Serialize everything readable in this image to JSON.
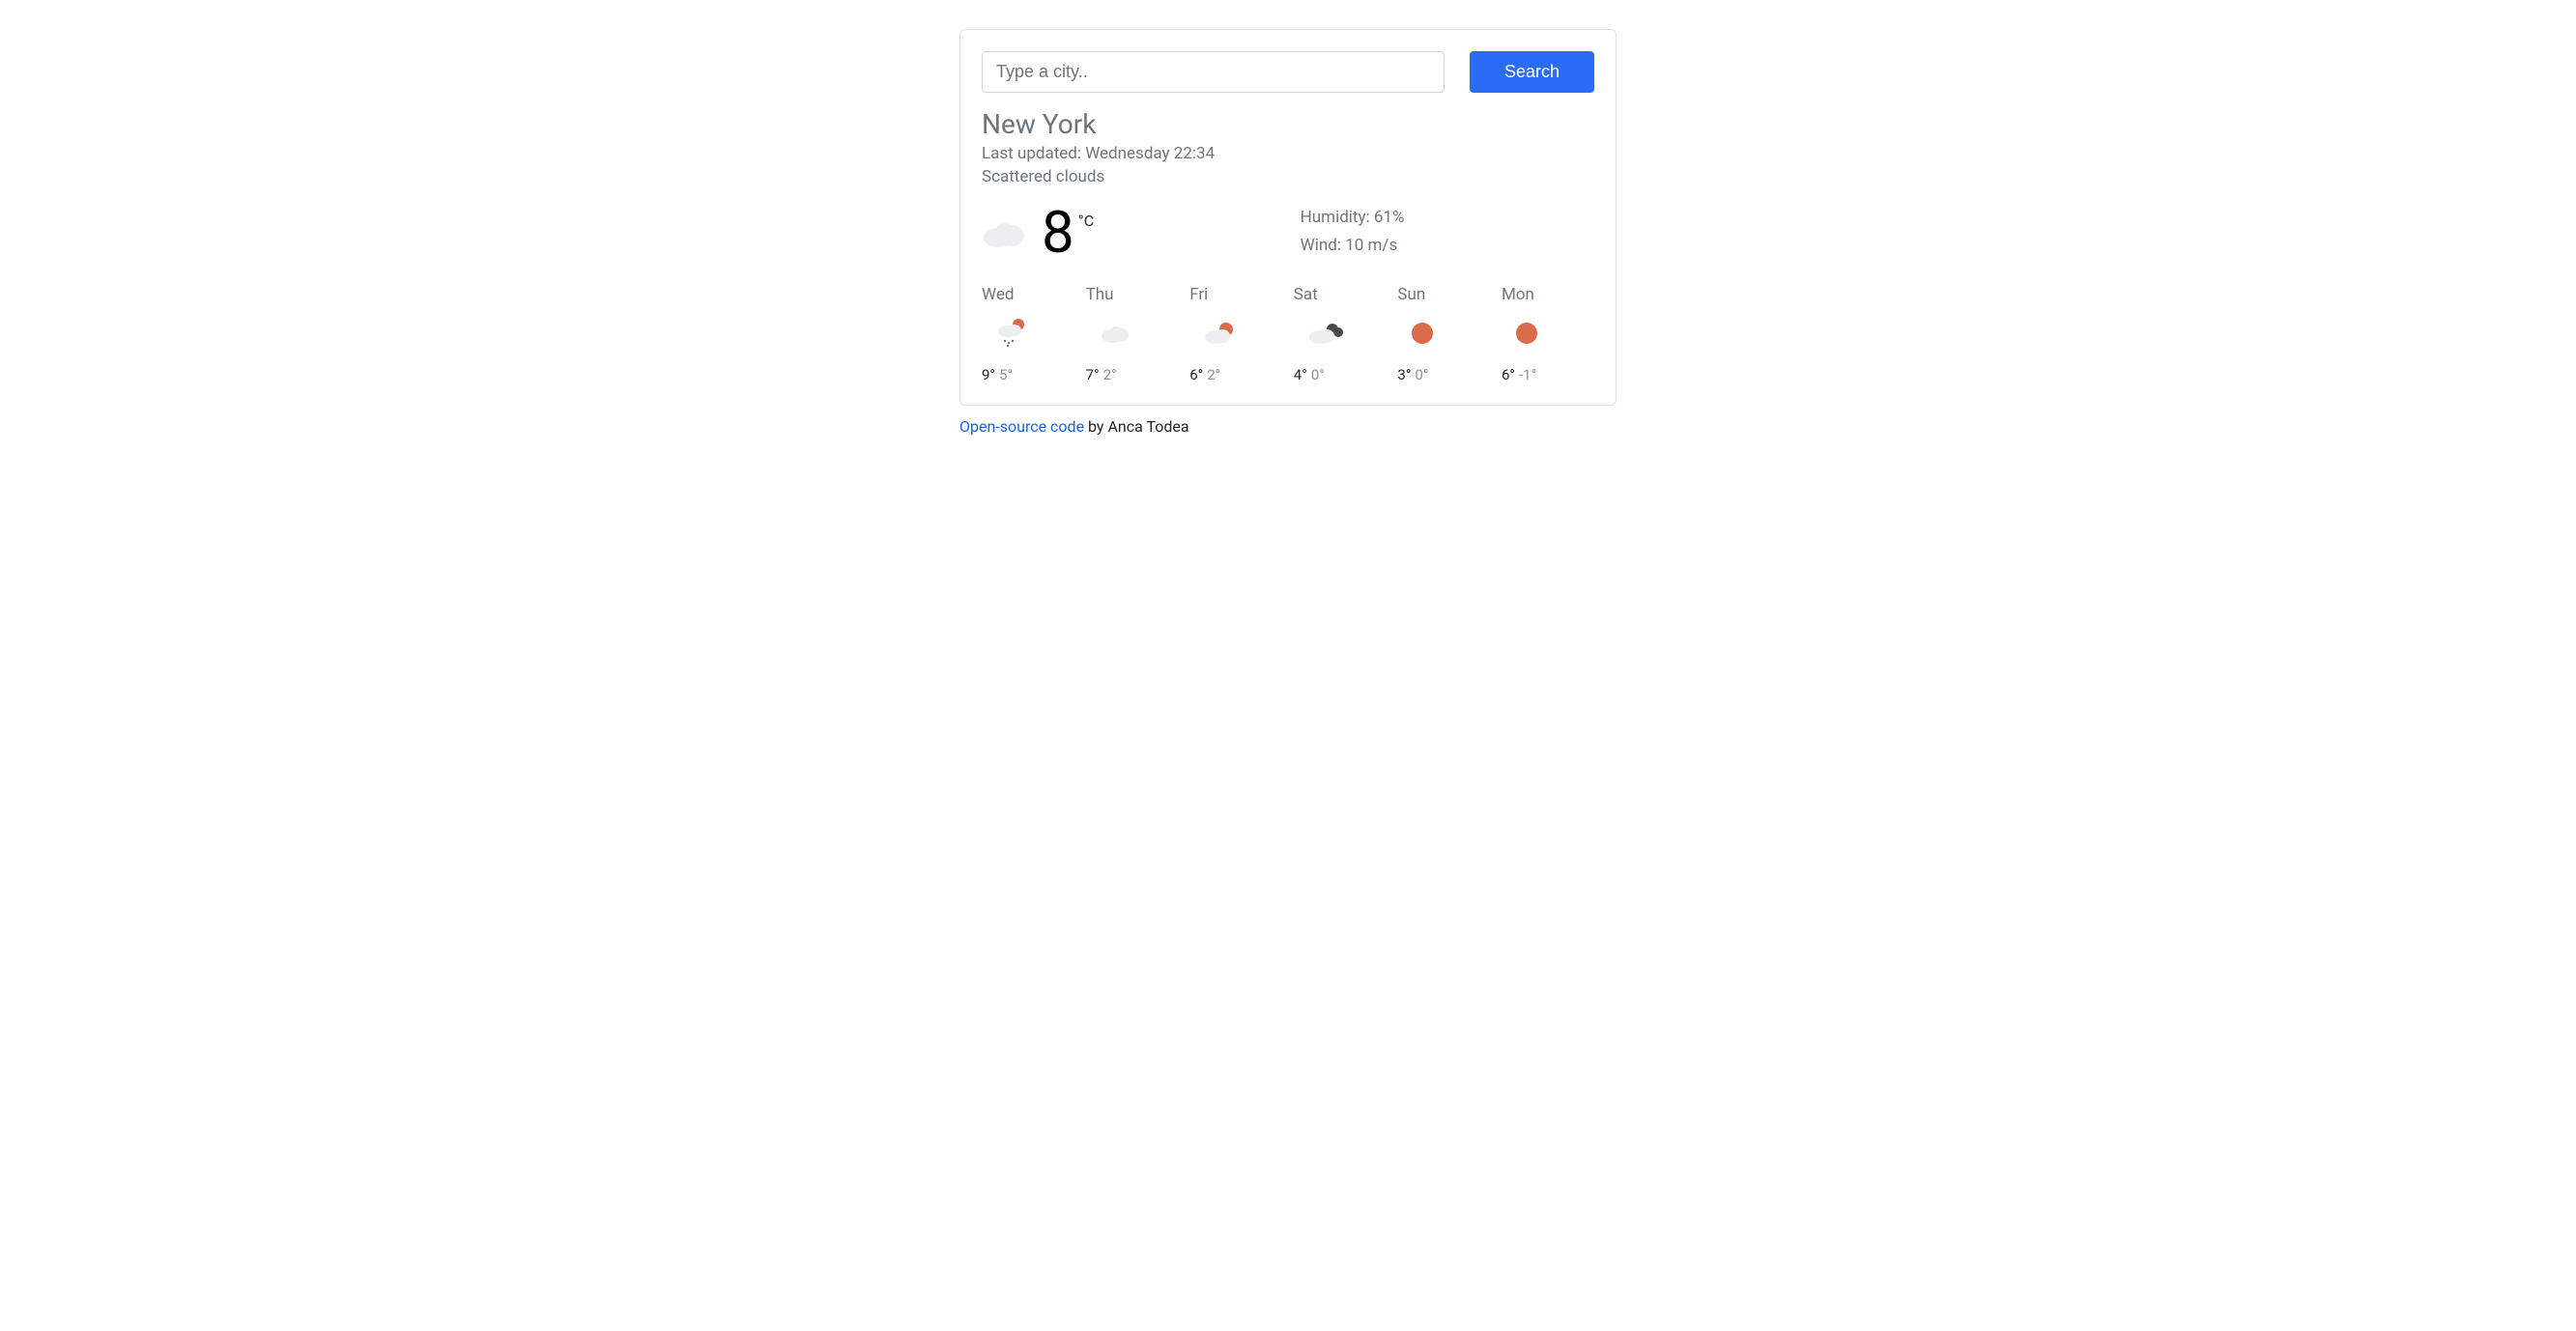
{
  "search": {
    "placeholder": "Type a city..",
    "button_label": "Search"
  },
  "city": "New York",
  "last_updated_prefix": "Last updated: ",
  "last_updated_value": "Wednesday 22:34",
  "condition": "Scattered clouds",
  "current": {
    "temp": "8",
    "unit": "°C",
    "humidity_label": "Humidity: ",
    "humidity_value": "61%",
    "wind_label": "Wind: ",
    "wind_value": "10 m/s",
    "icon": "cloud"
  },
  "forecast": [
    {
      "day": "Wed",
      "icon": "sun-cloud-rain",
      "hi": "9°",
      "lo": "5°"
    },
    {
      "day": "Thu",
      "icon": "cloud",
      "hi": "7°",
      "lo": "2°"
    },
    {
      "day": "Fri",
      "icon": "sun-cloud",
      "hi": "6°",
      "lo": "2°"
    },
    {
      "day": "Sat",
      "icon": "dark-cloud",
      "hi": "4°",
      "lo": "0°"
    },
    {
      "day": "Sun",
      "icon": "sun",
      "hi": "3°",
      "lo": "0°"
    },
    {
      "day": "Mon",
      "icon": "sun",
      "hi": "6°",
      "lo": "-1°"
    }
  ],
  "footer": {
    "link_text": "Open-source code",
    "by_text": " by Anca Todea"
  }
}
